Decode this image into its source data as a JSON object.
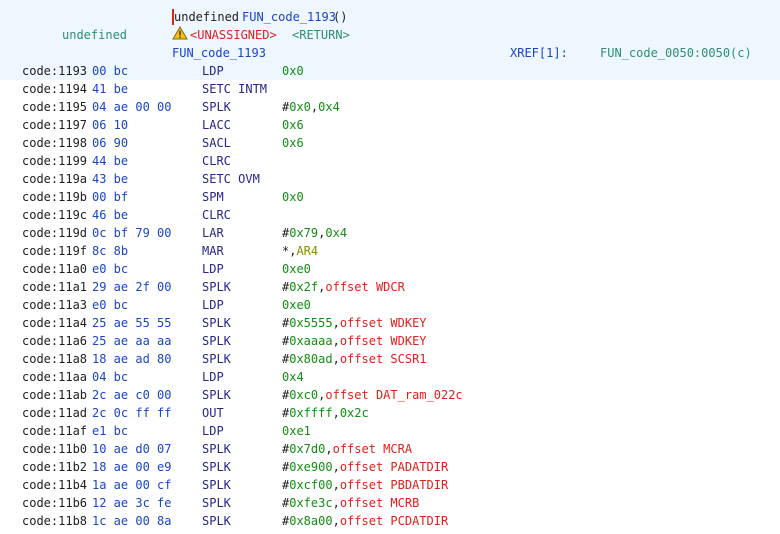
{
  "header": {
    "return_type_left": "undefined",
    "signature_type": "undefined",
    "signature_name": "FUN_code_1193",
    "signature_parens": "()",
    "unassigned_label": "<UNASSIGNED>",
    "return_label": "<RETURN>",
    "function_label": "FUN_code_1193",
    "xref_label": "XREF[1]:",
    "xref_target": "FUN_code_0050:0050(c)"
  },
  "rows": [
    {
      "addr": "code:1193",
      "bytes": "00 bc",
      "mnem": "LDP",
      "ops": [
        {
          "t": "0x0",
          "c": "green"
        }
      ]
    },
    {
      "addr": "code:1194",
      "bytes": "41 be",
      "mnem": "SETC INTM",
      "ops": []
    },
    {
      "addr": "code:1195",
      "bytes": "04 ae 00 00",
      "mnem": "SPLK",
      "ops": [
        {
          "t": "#",
          "c": "black"
        },
        {
          "t": "0x0",
          "c": "green"
        },
        {
          "t": ",",
          "c": "black"
        },
        {
          "t": "0x4",
          "c": "green"
        }
      ]
    },
    {
      "addr": "code:1197",
      "bytes": "06 10",
      "mnem": "LACC",
      "ops": [
        {
          "t": "0x6",
          "c": "green"
        }
      ]
    },
    {
      "addr": "code:1198",
      "bytes": "06 90",
      "mnem": "SACL",
      "ops": [
        {
          "t": "0x6",
          "c": "green"
        }
      ]
    },
    {
      "addr": "code:1199",
      "bytes": "44 be",
      "mnem": "CLRC",
      "ops": []
    },
    {
      "addr": "code:119a",
      "bytes": "43 be",
      "mnem": "SETC OVM",
      "ops": []
    },
    {
      "addr": "code:119b",
      "bytes": "00 bf",
      "mnem": "SPM",
      "ops": [
        {
          "t": "0x0",
          "c": "green"
        }
      ]
    },
    {
      "addr": "code:119c",
      "bytes": "46 be",
      "mnem": "CLRC",
      "ops": []
    },
    {
      "addr": "code:119d",
      "bytes": "0c bf 79 00",
      "mnem": "LAR",
      "ops": [
        {
          "t": "#",
          "c": "black"
        },
        {
          "t": "0x79",
          "c": "green"
        },
        {
          "t": ",",
          "c": "black"
        },
        {
          "t": "0x4",
          "c": "green"
        }
      ]
    },
    {
      "addr": "code:119f",
      "bytes": "8c 8b",
      "mnem": "MAR",
      "ops": [
        {
          "t": "*,",
          "c": "black"
        },
        {
          "t": "AR4",
          "c": "olive"
        }
      ]
    },
    {
      "addr": "code:11a0",
      "bytes": "e0 bc",
      "mnem": "LDP",
      "ops": [
        {
          "t": "0xe0",
          "c": "green"
        }
      ]
    },
    {
      "addr": "code:11a1",
      "bytes": "29 ae 2f 00",
      "mnem": "SPLK",
      "ops": [
        {
          "t": "#",
          "c": "black"
        },
        {
          "t": "0x2f",
          "c": "green"
        },
        {
          "t": ",",
          "c": "black"
        },
        {
          "t": "offset WDCR",
          "c": "red"
        }
      ]
    },
    {
      "addr": "code:11a3",
      "bytes": "e0 bc",
      "mnem": "LDP",
      "ops": [
        {
          "t": "0xe0",
          "c": "green"
        }
      ]
    },
    {
      "addr": "code:11a4",
      "bytes": "25 ae 55 55",
      "mnem": "SPLK",
      "ops": [
        {
          "t": "#",
          "c": "black"
        },
        {
          "t": "0x5555",
          "c": "green"
        },
        {
          "t": ",",
          "c": "black"
        },
        {
          "t": "offset WDKEY",
          "c": "red"
        }
      ]
    },
    {
      "addr": "code:11a6",
      "bytes": "25 ae aa aa",
      "mnem": "SPLK",
      "ops": [
        {
          "t": "#",
          "c": "black"
        },
        {
          "t": "0xaaaa",
          "c": "green"
        },
        {
          "t": ",",
          "c": "black"
        },
        {
          "t": "offset WDKEY",
          "c": "red"
        }
      ]
    },
    {
      "addr": "code:11a8",
      "bytes": "18 ae ad 80",
      "mnem": "SPLK",
      "ops": [
        {
          "t": "#",
          "c": "black"
        },
        {
          "t": "0x80ad",
          "c": "green"
        },
        {
          "t": ",",
          "c": "black"
        },
        {
          "t": "offset SCSR1",
          "c": "red"
        }
      ]
    },
    {
      "addr": "code:11aa",
      "bytes": "04 bc",
      "mnem": "LDP",
      "ops": [
        {
          "t": "0x4",
          "c": "green"
        }
      ]
    },
    {
      "addr": "code:11ab",
      "bytes": "2c ae c0 00",
      "mnem": "SPLK",
      "ops": [
        {
          "t": "#",
          "c": "black"
        },
        {
          "t": "0xc0",
          "c": "green"
        },
        {
          "t": ",",
          "c": "black"
        },
        {
          "t": "offset DAT_ram_022c",
          "c": "red"
        }
      ]
    },
    {
      "addr": "code:11ad",
      "bytes": "2c 0c ff ff",
      "mnem": "OUT",
      "ops": [
        {
          "t": "#",
          "c": "black"
        },
        {
          "t": "0xffff",
          "c": "green"
        },
        {
          "t": ",",
          "c": "black"
        },
        {
          "t": "0x2c",
          "c": "green"
        }
      ]
    },
    {
      "addr": "code:11af",
      "bytes": "e1 bc",
      "mnem": "LDP",
      "ops": [
        {
          "t": "0xe1",
          "c": "green"
        }
      ]
    },
    {
      "addr": "code:11b0",
      "bytes": "10 ae d0 07",
      "mnem": "SPLK",
      "ops": [
        {
          "t": "#",
          "c": "black"
        },
        {
          "t": "0x7d0",
          "c": "green"
        },
        {
          "t": ",",
          "c": "black"
        },
        {
          "t": "offset MCRA",
          "c": "red"
        }
      ]
    },
    {
      "addr": "code:11b2",
      "bytes": "18 ae 00 e9",
      "mnem": "SPLK",
      "ops": [
        {
          "t": "#",
          "c": "black"
        },
        {
          "t": "0xe900",
          "c": "green"
        },
        {
          "t": ",",
          "c": "black"
        },
        {
          "t": "offset PADATDIR",
          "c": "red"
        }
      ]
    },
    {
      "addr": "code:11b4",
      "bytes": "1a ae 00 cf",
      "mnem": "SPLK",
      "ops": [
        {
          "t": "#",
          "c": "black"
        },
        {
          "t": "0xcf00",
          "c": "green"
        },
        {
          "t": ",",
          "c": "black"
        },
        {
          "t": "offset PBDATDIR",
          "c": "red"
        }
      ]
    },
    {
      "addr": "code:11b6",
      "bytes": "12 ae 3c fe",
      "mnem": "SPLK",
      "ops": [
        {
          "t": "#",
          "c": "black"
        },
        {
          "t": "0xfe3c",
          "c": "green"
        },
        {
          "t": ",",
          "c": "black"
        },
        {
          "t": "offset MCRB",
          "c": "red"
        }
      ]
    },
    {
      "addr": "code:11b8",
      "bytes": "1c ae 00 8a",
      "mnem": "SPLK",
      "ops": [
        {
          "t": "#",
          "c": "black"
        },
        {
          "t": "0x8a00",
          "c": "green"
        },
        {
          "t": ",",
          "c": "black"
        },
        {
          "t": "offset PCDATDIR",
          "c": "red"
        }
      ]
    }
  ],
  "colors": {
    "header_bg": "#eef6ff",
    "name": "#1a44c8",
    "label": "#2f8f6e",
    "warning": "#e0201b",
    "scalar": "#128e12",
    "register": "#8a8a00"
  },
  "icons": {
    "warning": "warning-triangle-icon"
  }
}
